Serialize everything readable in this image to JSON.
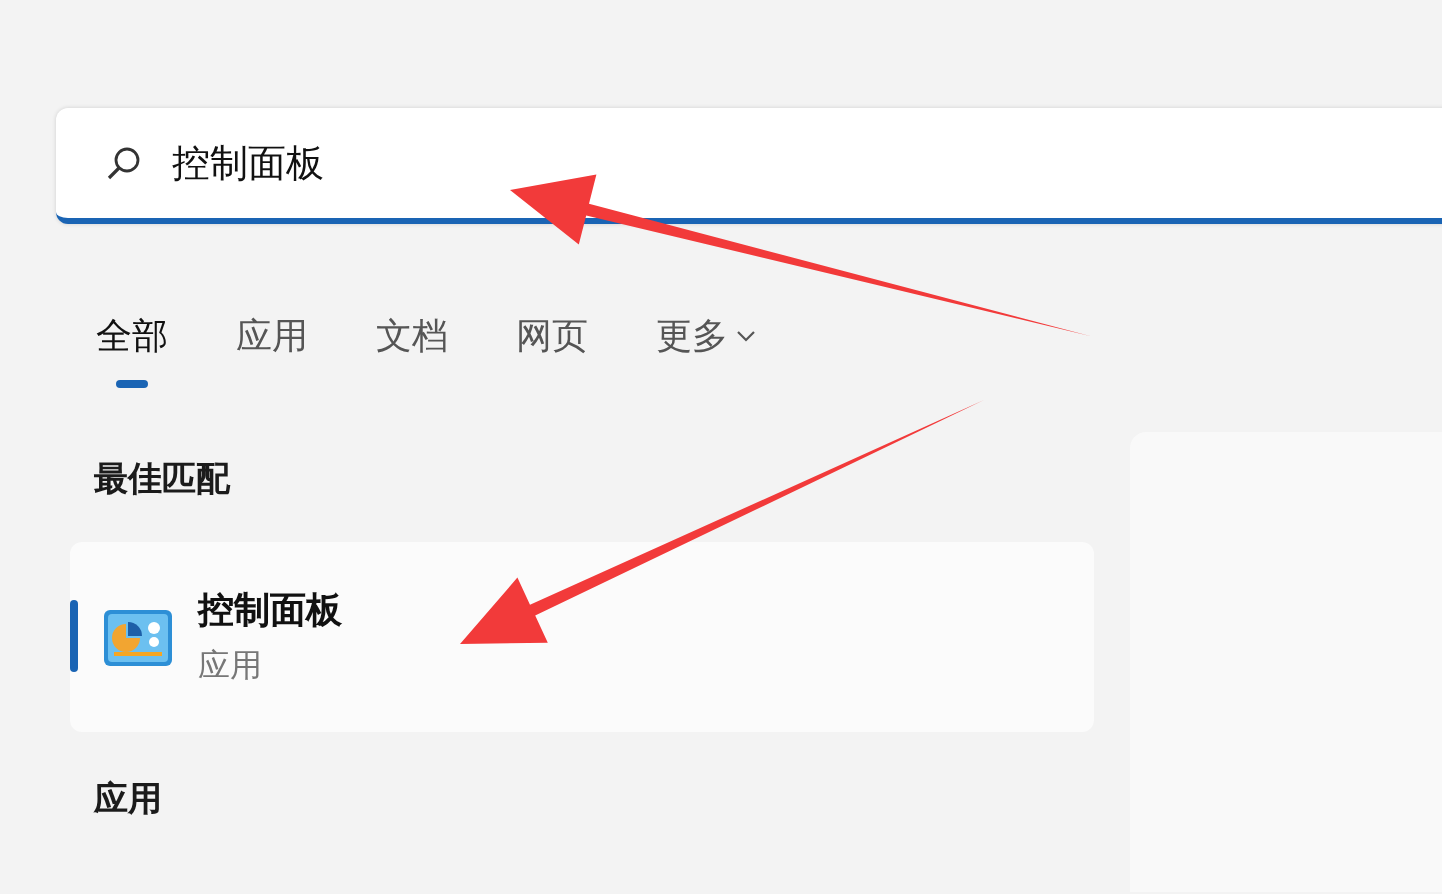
{
  "search": {
    "value": "控制面板"
  },
  "tabs": [
    {
      "label": "全部",
      "selected": true,
      "kind": "tab"
    },
    {
      "label": "应用",
      "selected": false,
      "kind": "tab"
    },
    {
      "label": "文档",
      "selected": false,
      "kind": "tab"
    },
    {
      "label": "网页",
      "selected": false,
      "kind": "tab"
    },
    {
      "label": "更多",
      "selected": false,
      "kind": "dropdown"
    }
  ],
  "best_match": {
    "heading": "最佳匹配",
    "result": {
      "title": "控制面板",
      "subtitle": "应用",
      "selected": true
    }
  },
  "apps": {
    "heading": "应用"
  }
}
